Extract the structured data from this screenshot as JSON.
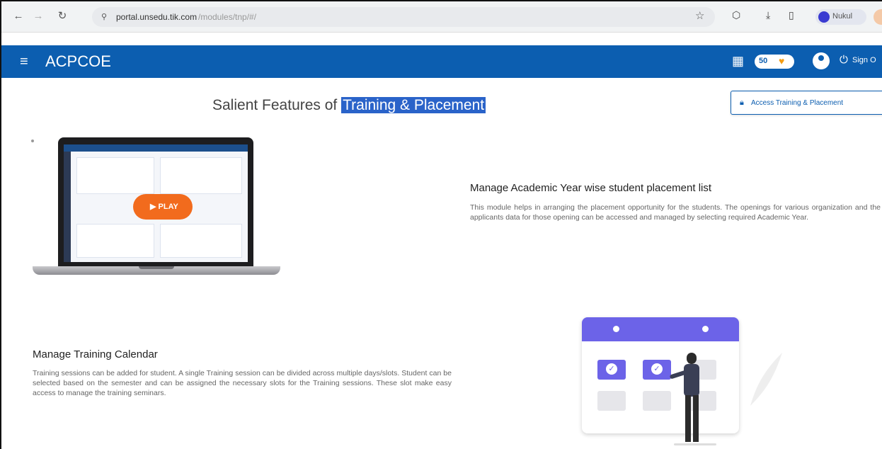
{
  "browser": {
    "url_host": "portal.unsedu.tik.com",
    "url_path": "/modules/tnp/#/",
    "profile_name": "Nukul"
  },
  "header": {
    "brand": "ACPCOE",
    "coins": "50",
    "signout_label": "Sign O"
  },
  "page": {
    "title_prefix": "Salient Features of ",
    "title_highlight": "Training & Placement",
    "access_button_label": "Access Training & Placement"
  },
  "video": {
    "play_label": "▶ PLAY"
  },
  "features": [
    {
      "title": "Manage Academic Year wise student placement list",
      "description": "This module helps in arranging the placement opportunity for the students. The openings for various organization and the applicants data for those opening can be accessed and managed by selecting required Academic Year."
    },
    {
      "title": "Manage Training Calendar",
      "description": "Training sessions can be added for student. A single Training session can be divided across multiple days/slots. Student can be selected based on the semester and can be assigned the necessary slots for the Training sessions. These slot make easy access to manage the training seminars."
    }
  ],
  "colors": {
    "header_bg": "#0c5eb0",
    "highlight_bg": "#2a63c9",
    "play_button": "#f26b1d",
    "calendar_accent": "#6c63e8"
  },
  "icons": {
    "back": "back-arrow-icon",
    "forward": "forward-arrow-icon",
    "reload": "reload-icon",
    "bookmark": "star-icon",
    "menu": "hamburger-icon",
    "apps": "grid-icon",
    "account": "account-icon",
    "power": "power-icon",
    "lock": "lock-icon"
  }
}
